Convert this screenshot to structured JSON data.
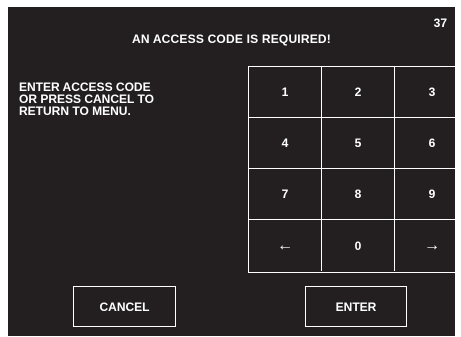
{
  "header": {
    "title": "AN ACCESS CODE IS REQUIRED!",
    "screen_number": "37"
  },
  "instructions": "ENTER ACCESS CODE\nOR PRESS CANCEL TO\nRETURN TO MENU.",
  "keypad": {
    "keys": [
      "1",
      "2",
      "3",
      "4",
      "5",
      "6",
      "7",
      "8",
      "9",
      "←",
      "0",
      "→"
    ]
  },
  "buttons": {
    "cancel_label": "CANCEL",
    "enter_label": "ENTER"
  },
  "colors": {
    "background": "#231f20",
    "foreground": "#ffffff"
  }
}
